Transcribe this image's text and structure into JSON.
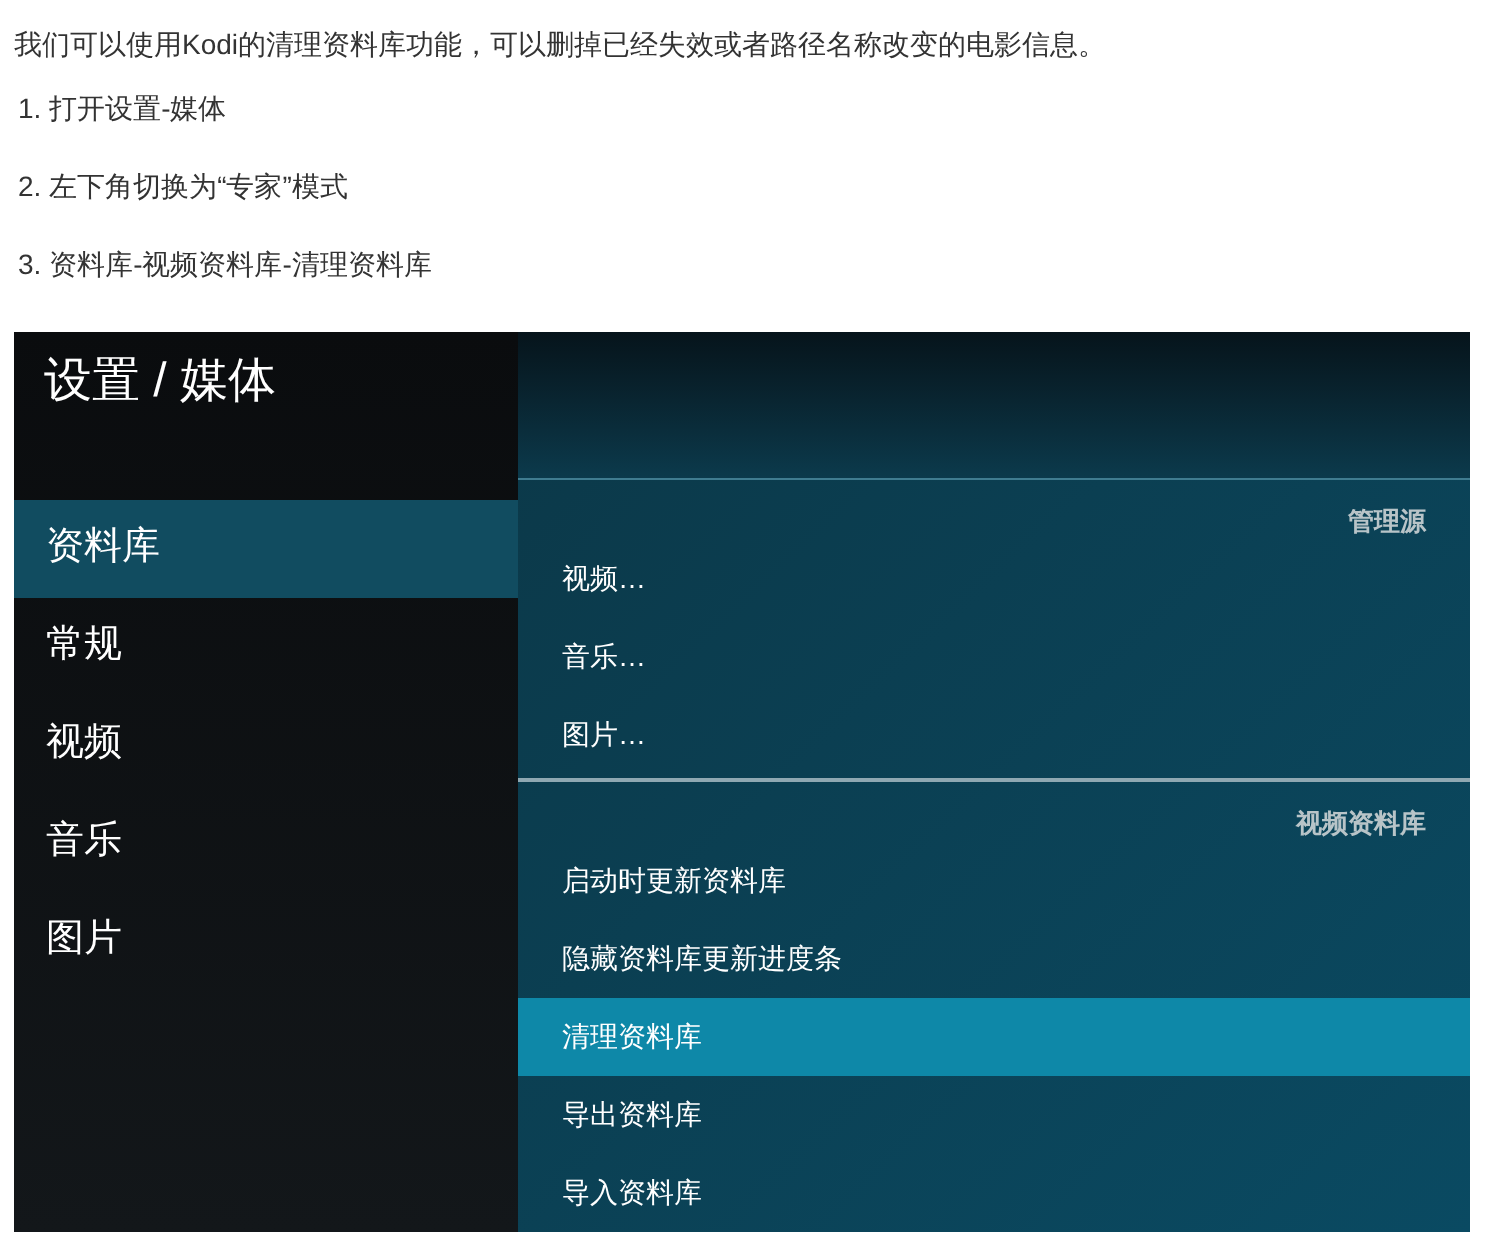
{
  "intro": "我们可以使用Kodi的清理资料库功能，可以删掉已经失效或者路径名称改变的电影信息。",
  "steps": [
    "1. 打开设置-媒体",
    "2. 左下角切换为“专家”模式",
    "3. 资料库-视频资料库-清理资料库"
  ],
  "kodi": {
    "title": "设置 / 媒体",
    "sidebar": [
      {
        "label": "资料库",
        "selected": true
      },
      {
        "label": "常规",
        "selected": false
      },
      {
        "label": "视频",
        "selected": false
      },
      {
        "label": "音乐",
        "selected": false
      },
      {
        "label": "图片",
        "selected": false
      }
    ],
    "sections": [
      {
        "header": "管理源",
        "items": [
          {
            "label": "视频…",
            "selected": false
          },
          {
            "label": "音乐…",
            "selected": false
          },
          {
            "label": "图片…",
            "selected": false
          }
        ]
      },
      {
        "header": "视频资料库",
        "items": [
          {
            "label": "启动时更新资料库",
            "selected": false
          },
          {
            "label": "隐藏资料库更新进度条",
            "selected": false
          },
          {
            "label": "清理资料库",
            "selected": true
          },
          {
            "label": "导出资料库",
            "selected": false
          },
          {
            "label": "导入资料库",
            "selected": false
          }
        ]
      }
    ]
  }
}
